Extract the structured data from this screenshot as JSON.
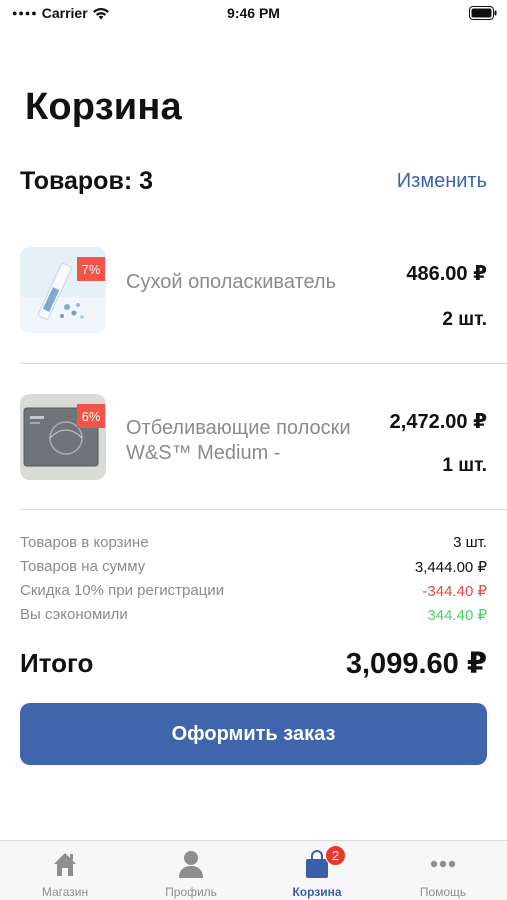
{
  "status_bar": {
    "carrier": "Carrier",
    "time": "9:46 PM"
  },
  "page": {
    "title": "Корзина"
  },
  "cart": {
    "count_label": "Товаров: 3",
    "edit_label": "Изменить"
  },
  "items": [
    {
      "name": "Сухой ополаскиватель",
      "price": "486.00 ₽",
      "qty": "2 шт.",
      "discount": "7%"
    },
    {
      "name": "Отбеливающие полоски W&S™ Medium   -",
      "price": "2,472.00 ₽",
      "qty": "1 шт.",
      "discount": "6%"
    }
  ],
  "summary": {
    "in_cart_label": "Товаров в корзине",
    "in_cart_value": "3 шт.",
    "sum_label": "Товаров на сумму",
    "sum_value": "3,444.00 ₽",
    "discount_label": "Скидка 10% при регистрации",
    "discount_value": "-344.40 ₽",
    "saved_label": "Вы сэкономили",
    "saved_value": "344.40 ₽"
  },
  "total": {
    "label": "Итого",
    "value": "3,099.60 ₽"
  },
  "checkout": {
    "label": "Оформить заказ"
  },
  "tabs": [
    {
      "label": "Магазин",
      "icon": "home-icon"
    },
    {
      "label": "Профиль",
      "icon": "person-icon"
    },
    {
      "label": "Корзина",
      "icon": "bag-icon",
      "badge": "2"
    },
    {
      "label": "Помощь",
      "icon": "more-icon"
    }
  ],
  "colors": {
    "accent": "#4065ad",
    "negative": "#e84a43",
    "positive": "#4cd267",
    "badge": "#f1554a"
  }
}
